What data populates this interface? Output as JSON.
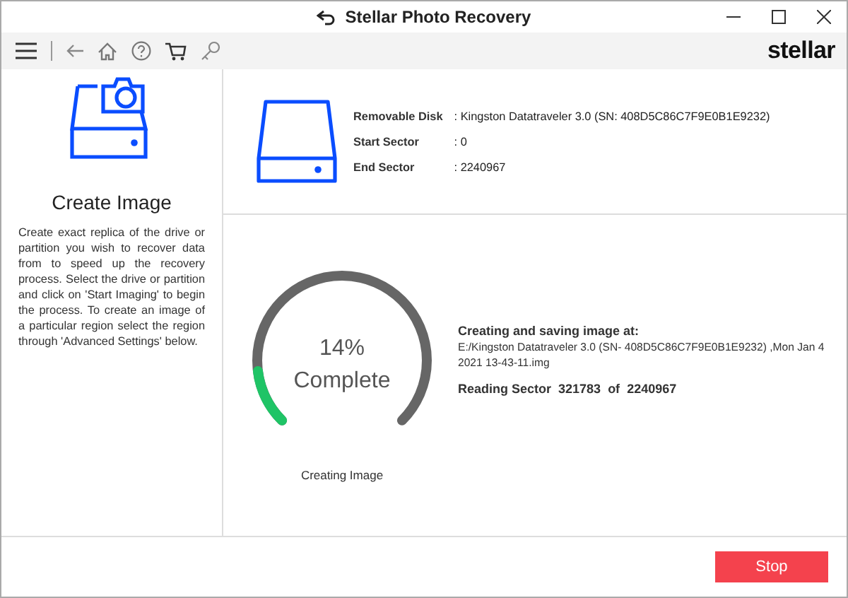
{
  "window": {
    "title": "Stellar Photo Recovery"
  },
  "toolbar": {
    "brand": "stellar"
  },
  "sidebar": {
    "title": "Create Image",
    "description": "Create exact replica of the drive or partition you wish to recover data from to speed up the recovery process. Select the drive or partition and click on 'Start Imaging' to begin the process. To create an image of a particular region select the region through 'Advanced Settings' below."
  },
  "drive_info": [
    {
      "label": "Removable Disk",
      "value": ": Kingston Datatraveler 3.0 (SN: 408D5C86C7F9E0B1E9232)"
    },
    {
      "label": "Start Sector",
      "value": ": 0"
    },
    {
      "label": "End Sector",
      "value": ": 2240967"
    }
  ],
  "progress": {
    "percent": "14%",
    "status": "Complete",
    "level": 0.14,
    "caption": "Creating Image",
    "heading": "Creating and saving image at:",
    "path": "E:/Kingston Datatraveler 3.0 (SN- 408D5C86C7F9E0B1E9232) ,Mon Jan 4 2021 13-43-11.img",
    "reading_label": "Reading Sector",
    "reading_value": "321783",
    "reading_of": "of",
    "reading_total": "2240967"
  },
  "buttons": [
    {
      "label": "Stop"
    }
  ]
}
